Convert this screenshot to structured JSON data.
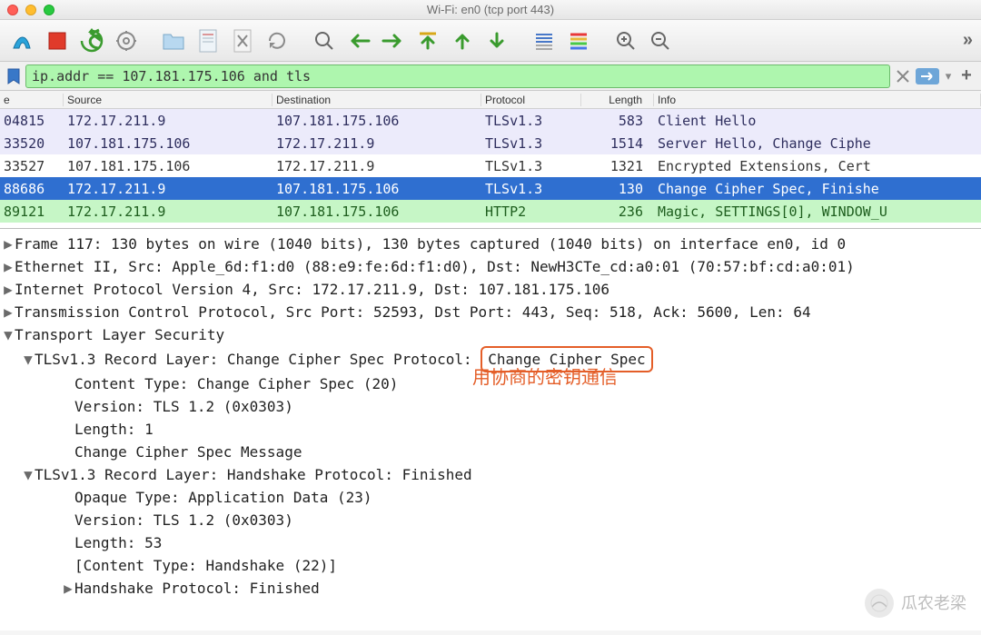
{
  "window": {
    "title": "Wi-Fi: en0 (tcp port 443)"
  },
  "toolbar": {
    "icons": [
      "fin",
      "stop",
      "restart",
      "settings",
      "open",
      "save",
      "close",
      "reload",
      "find",
      "go-back",
      "go-forward",
      "go-first",
      "go-up",
      "go-down",
      "auto-scroll",
      "colorize",
      "zoom-in",
      "zoom-out"
    ],
    "more": "»"
  },
  "filter": {
    "expression": "ip.addr == 107.181.175.106 and tls",
    "clear": "×",
    "add": "+"
  },
  "table": {
    "headers": {
      "time": "e",
      "src": "Source",
      "dst": "Destination",
      "proto": "Protocol",
      "len": "Length",
      "info": "Info"
    },
    "rows": [
      {
        "cls": "purple",
        "time": "04815",
        "src": "172.17.211.9",
        "dst": "107.181.175.106",
        "proto": "TLSv1.3",
        "len": "583",
        "info": "Client Hello"
      },
      {
        "cls": "purple",
        "time": "33520",
        "src": "107.181.175.106",
        "dst": "172.17.211.9",
        "proto": "TLSv1.3",
        "len": "1514",
        "info": "Server Hello, Change Ciphe"
      },
      {
        "cls": "blue",
        "time": "33527",
        "src": "107.181.175.106",
        "dst": "172.17.211.9",
        "proto": "TLSv1.3",
        "len": "1321",
        "info": "Encrypted Extensions, Cert"
      },
      {
        "cls": "selected",
        "time": "88686",
        "src": "172.17.211.9",
        "dst": "107.181.175.106",
        "proto": "TLSv1.3",
        "len": "130",
        "info": "Change Cipher Spec, Finishe"
      },
      {
        "cls": "green",
        "time": "89121",
        "src": "172.17.211.9",
        "dst": "107.181.175.106",
        "proto": "HTTP2",
        "len": "236",
        "info": "Magic, SETTINGS[0], WINDOW_U"
      }
    ]
  },
  "details": {
    "lines": [
      {
        "lvl": 1,
        "tri": "▶",
        "text": "Frame 117: 130 bytes on wire (1040 bits), 130 bytes captured (1040 bits) on interface en0, id 0"
      },
      {
        "lvl": 1,
        "tri": "▶",
        "text": "Ethernet II, Src: Apple_6d:f1:d0 (88:e9:fe:6d:f1:d0), Dst: NewH3CTe_cd:a0:01 (70:57:bf:cd:a0:01)"
      },
      {
        "lvl": 1,
        "tri": "▶",
        "text": "Internet Protocol Version 4, Src: 172.17.211.9, Dst: 107.181.175.106"
      },
      {
        "lvl": 1,
        "tri": "▶",
        "text": "Transmission Control Protocol, Src Port: 52593, Dst Port: 443, Seq: 518, Ack: 5600, Len: 64"
      },
      {
        "lvl": 1,
        "tri": "▼",
        "text": "Transport Layer Security"
      },
      {
        "lvl": 2,
        "tri": "▼",
        "text_pre": "TLSv1.3 Record Layer: Change Cipher Spec Protocol: ",
        "text_box": "Change Cipher Spec"
      },
      {
        "lvl": 3,
        "tri": "",
        "text": "Content Type: Change Cipher Spec (20)"
      },
      {
        "lvl": 3,
        "tri": "",
        "text": "Version: TLS 1.2 (0x0303)"
      },
      {
        "lvl": 3,
        "tri": "",
        "text": "Length: 1"
      },
      {
        "lvl": 3,
        "tri": "",
        "text": "Change Cipher Spec Message"
      },
      {
        "lvl": 2,
        "tri": "▼",
        "text": "TLSv1.3 Record Layer: Handshake Protocol: Finished"
      },
      {
        "lvl": 3,
        "tri": "",
        "text": "Opaque Type: Application Data (23)"
      },
      {
        "lvl": 3,
        "tri": "",
        "text": "Version: TLS 1.2 (0x0303)"
      },
      {
        "lvl": 3,
        "tri": "",
        "text": "Length: 53"
      },
      {
        "lvl": 3,
        "tri": "",
        "text": "[Content Type: Handshake (22)]"
      },
      {
        "lvl": 4,
        "tri": "▶",
        "text": "Handshake Protocol: Finished"
      }
    ]
  },
  "annotation": "用协商的密钥通信",
  "watermark": {
    "text": "瓜农老梁"
  }
}
